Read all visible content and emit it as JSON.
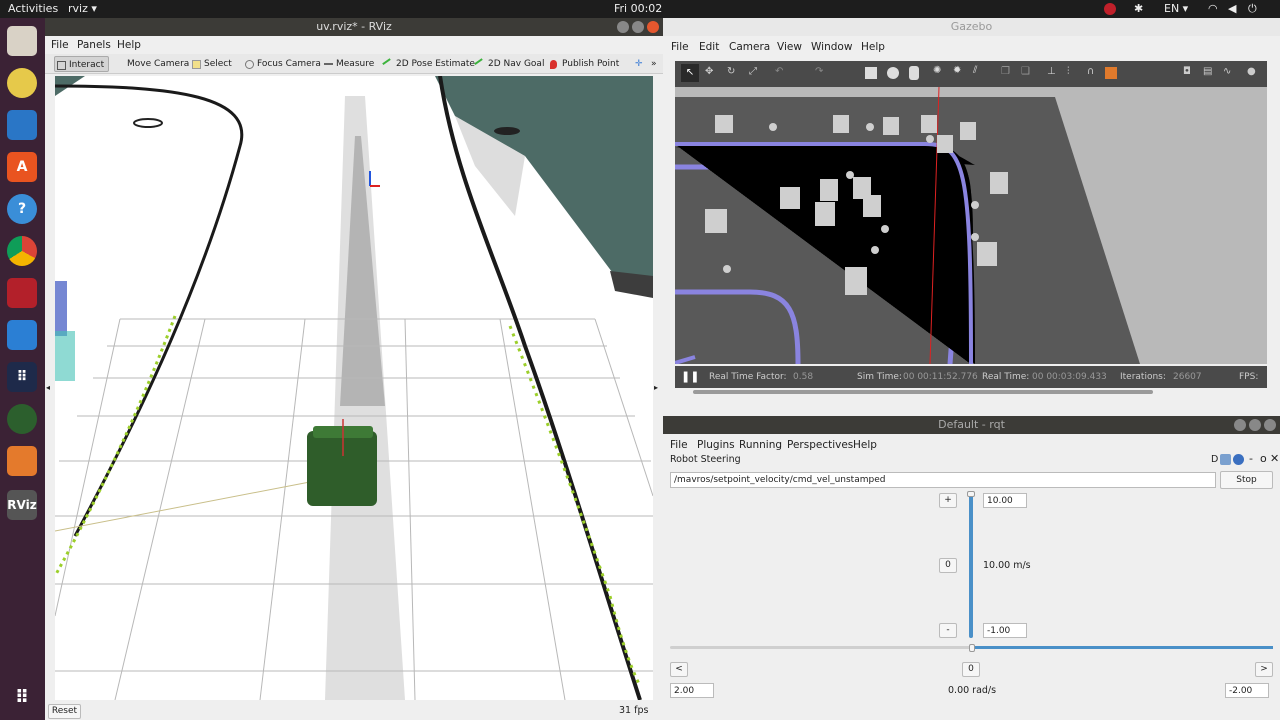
{
  "topbar": {
    "activities": "Activities",
    "app": "rviz ▾",
    "clock": "Fri 00:02",
    "lang": "EN ▾"
  },
  "rviz": {
    "title": "uv.rviz* - RViz",
    "menu": [
      "File",
      "Panels",
      "Help"
    ],
    "tools": [
      "Interact",
      "Move Camera",
      "Select",
      "Focus Camera",
      "Measure",
      "2D Pose Estimate",
      "2D Nav Goal",
      "Publish Point"
    ],
    "reset": "Reset",
    "fps": "31 fps"
  },
  "gazebo": {
    "title": "Gazebo",
    "menu": [
      "File",
      "Edit",
      "Camera",
      "View",
      "Window",
      "Help"
    ],
    "status": {
      "rtf_label": "Real Time Factor:",
      "rtf_value": "0.58",
      "sim_label": "Sim Time:",
      "sim_value": "00 00:11:52.776",
      "real_label": "Real Time:",
      "real_value": "00 00:03:09.433",
      "iter_label": "Iterations:",
      "iter_value": "26607",
      "fps_label": "FPS:"
    }
  },
  "rqt": {
    "title": "Default - rqt",
    "menu": [
      "File",
      "Plugins",
      "Running",
      "Perspectives",
      "Help"
    ],
    "plugin": "Robot Steering",
    "plugin_buttons": "D",
    "topic": "/mavros/setpoint_velocity/cmd_vel_unstamped",
    "stop": "Stop",
    "linear": {
      "plus": "+",
      "zero": "0",
      "minus": "-",
      "max": "10.00",
      "min": "-1.00",
      "value": "10.00 m/s",
      "level": 1.0
    },
    "angular": {
      "left": "<",
      "zero": "0",
      "right": ">",
      "max": "2.00",
      "min": "-2.00",
      "value": "0.00 rad/s",
      "level": 0.5
    }
  }
}
